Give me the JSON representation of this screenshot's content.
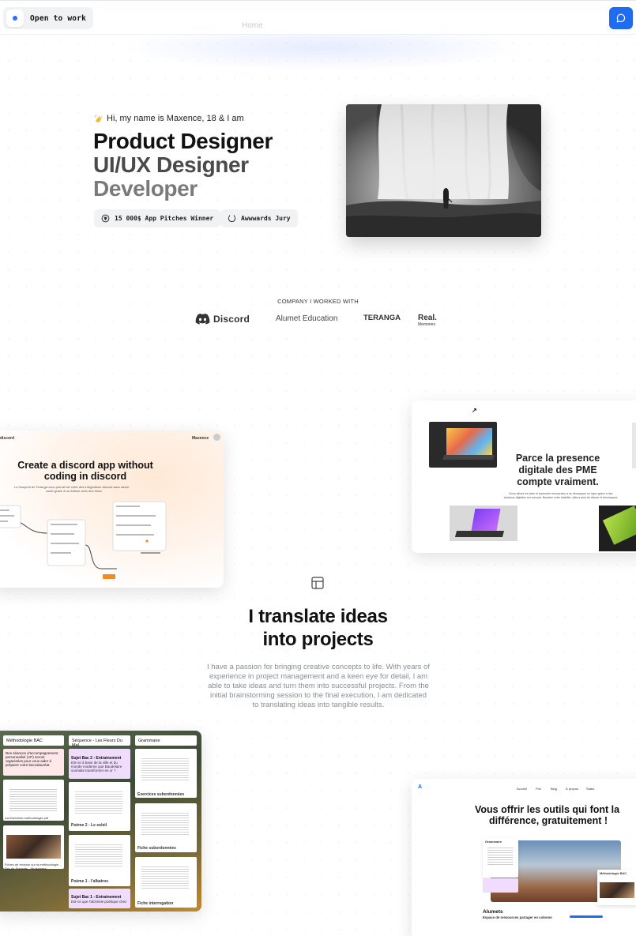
{
  "header": {
    "status_label": "Open to work",
    "nav_home": "Home",
    "chat_icon": "chat-bubble-icon",
    "accent": "#1f6cf2"
  },
  "hero": {
    "greeting": "Hi, my name is Maxence, 18 & I am",
    "greeting_icon": "waving-hand-icon",
    "roles": [
      "Product Designer",
      "UI/UX Designer",
      "Developer"
    ],
    "badges": [
      {
        "label": "15 000$ App Pitches Winner",
        "icon": "trophy-icon"
      },
      {
        "label": "Awwwards Jury",
        "icon": "laurel-icon"
      }
    ]
  },
  "companies": {
    "title": "COMPANY I WORKED WITH",
    "logos": [
      {
        "name": "Discord",
        "icon": "discord-icon"
      },
      {
        "name": "Alumet Education"
      },
      {
        "name": "TERANGA",
        "mark": "T"
      },
      {
        "name": "Real.",
        "sub": "Memories"
      }
    ]
  },
  "projects": {
    "discord": {
      "nav_left": "discord",
      "nav_right": "Maxence",
      "headline_1": "Create a discord app without",
      "headline_2": "coding in discord",
      "sub_1": "Le blueprint de Teranga vous permet de créer des intégrations discord sans savoir",
      "sub_2": "coder grâce à un éditeur avec des blocs"
    },
    "teranga": {
      "headline_1": "Parce la presence",
      "headline_2": "digitale des PME",
      "headline_3": "compte vraiment.",
      "sub": "Nous allons les faire et reprendre entreprises à se démarquer en ligne grâce à des solutions digitales sur mesure. Boostez votre visibilité, attirez plus de clients et développez."
    },
    "alumets_board": {
      "columns": [
        "Méthodologie BAC",
        "Séquence - Les Fleurs Du Mal",
        "Grammaire"
      ],
      "items": [
        "Des séances d'accompagnement personnalisé (AP) seront organisées pour vous aider à préparer votre baccalauréat.",
        "Sujet Bac 2 - Entrainement",
        "Est-ce à base de la ville et du monde moderne que Baudelaire souhaite transformer en or ?",
        "Poème 2 - Le soleil",
        "Exercices subordonnées",
        "commentaire-methodologie.pdf",
        "Fiche subordonnées",
        "Fiches de révision sur la méthodologie - Bac de Français - Studysama",
        "Poème 1 - l'albatros",
        "Fiche interrogation",
        "Sujet Bac 1 - Entrainement",
        "Est-ce que l'alchimie poétique chez"
      ]
    },
    "alumets_site": {
      "nav": [
        "Accueil",
        "Prix",
        "Blog",
        "À propos",
        "Statut"
      ],
      "headline_1": "Vous offrir les outils qui font la",
      "headline_2": "différence, gratuitement !",
      "card_title": "Alumets",
      "card_sub": "Espace de ressources partager en colonne",
      "tag_1": "Grammaire",
      "tag_2": "Méthodologie BAC"
    }
  },
  "statement": {
    "icon": "layout-icon",
    "line_1": "I translate ideas",
    "line_2": "into projects",
    "paragraph": "I have a passion for bringing creative concepts to life. With years of experience in project management and a keen eye for detail, I am able to take ideas and turn them into successful projects. From the initial brainstorming session to the final execution, I am dedicated to translating ideas into tangible results."
  }
}
